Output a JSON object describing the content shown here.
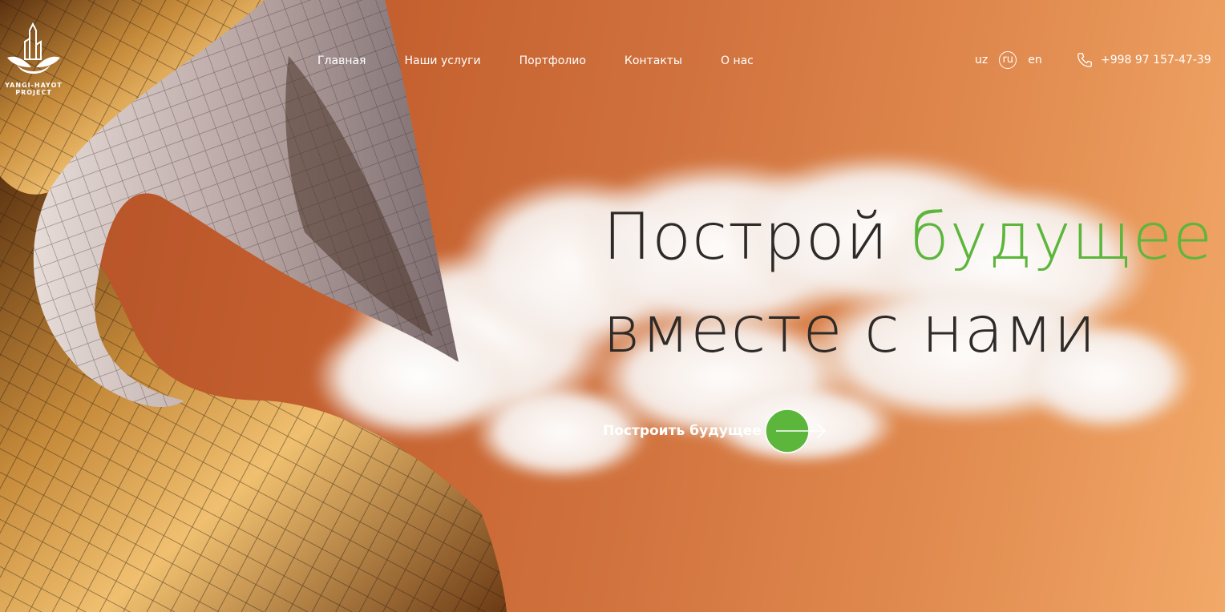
{
  "brand": {
    "logo_line1": "YANGI-HAYOT",
    "logo_line2": "PROJECT"
  },
  "nav": {
    "items": [
      {
        "label": "Главная"
      },
      {
        "label": "Наши услуги"
      },
      {
        "label": "Портфолио"
      },
      {
        "label": "Контакты"
      },
      {
        "label": "О нас"
      }
    ]
  },
  "languages": {
    "items": [
      "uz",
      "ru",
      "en"
    ],
    "active": "ru"
  },
  "contact": {
    "phone": "+998 97 157-47-39",
    "icon": "phone-icon"
  },
  "hero": {
    "headline_part1": "Построй ",
    "headline_accent": "будущее",
    "headline_part2": "вместе с нами",
    "cta_label": "Построить будущее",
    "cta_icon": "arrow-right-icon"
  },
  "colors": {
    "accent_green": "#5db63c",
    "background_orange": "#c4602f",
    "headline_dark": "#2d2a28"
  }
}
